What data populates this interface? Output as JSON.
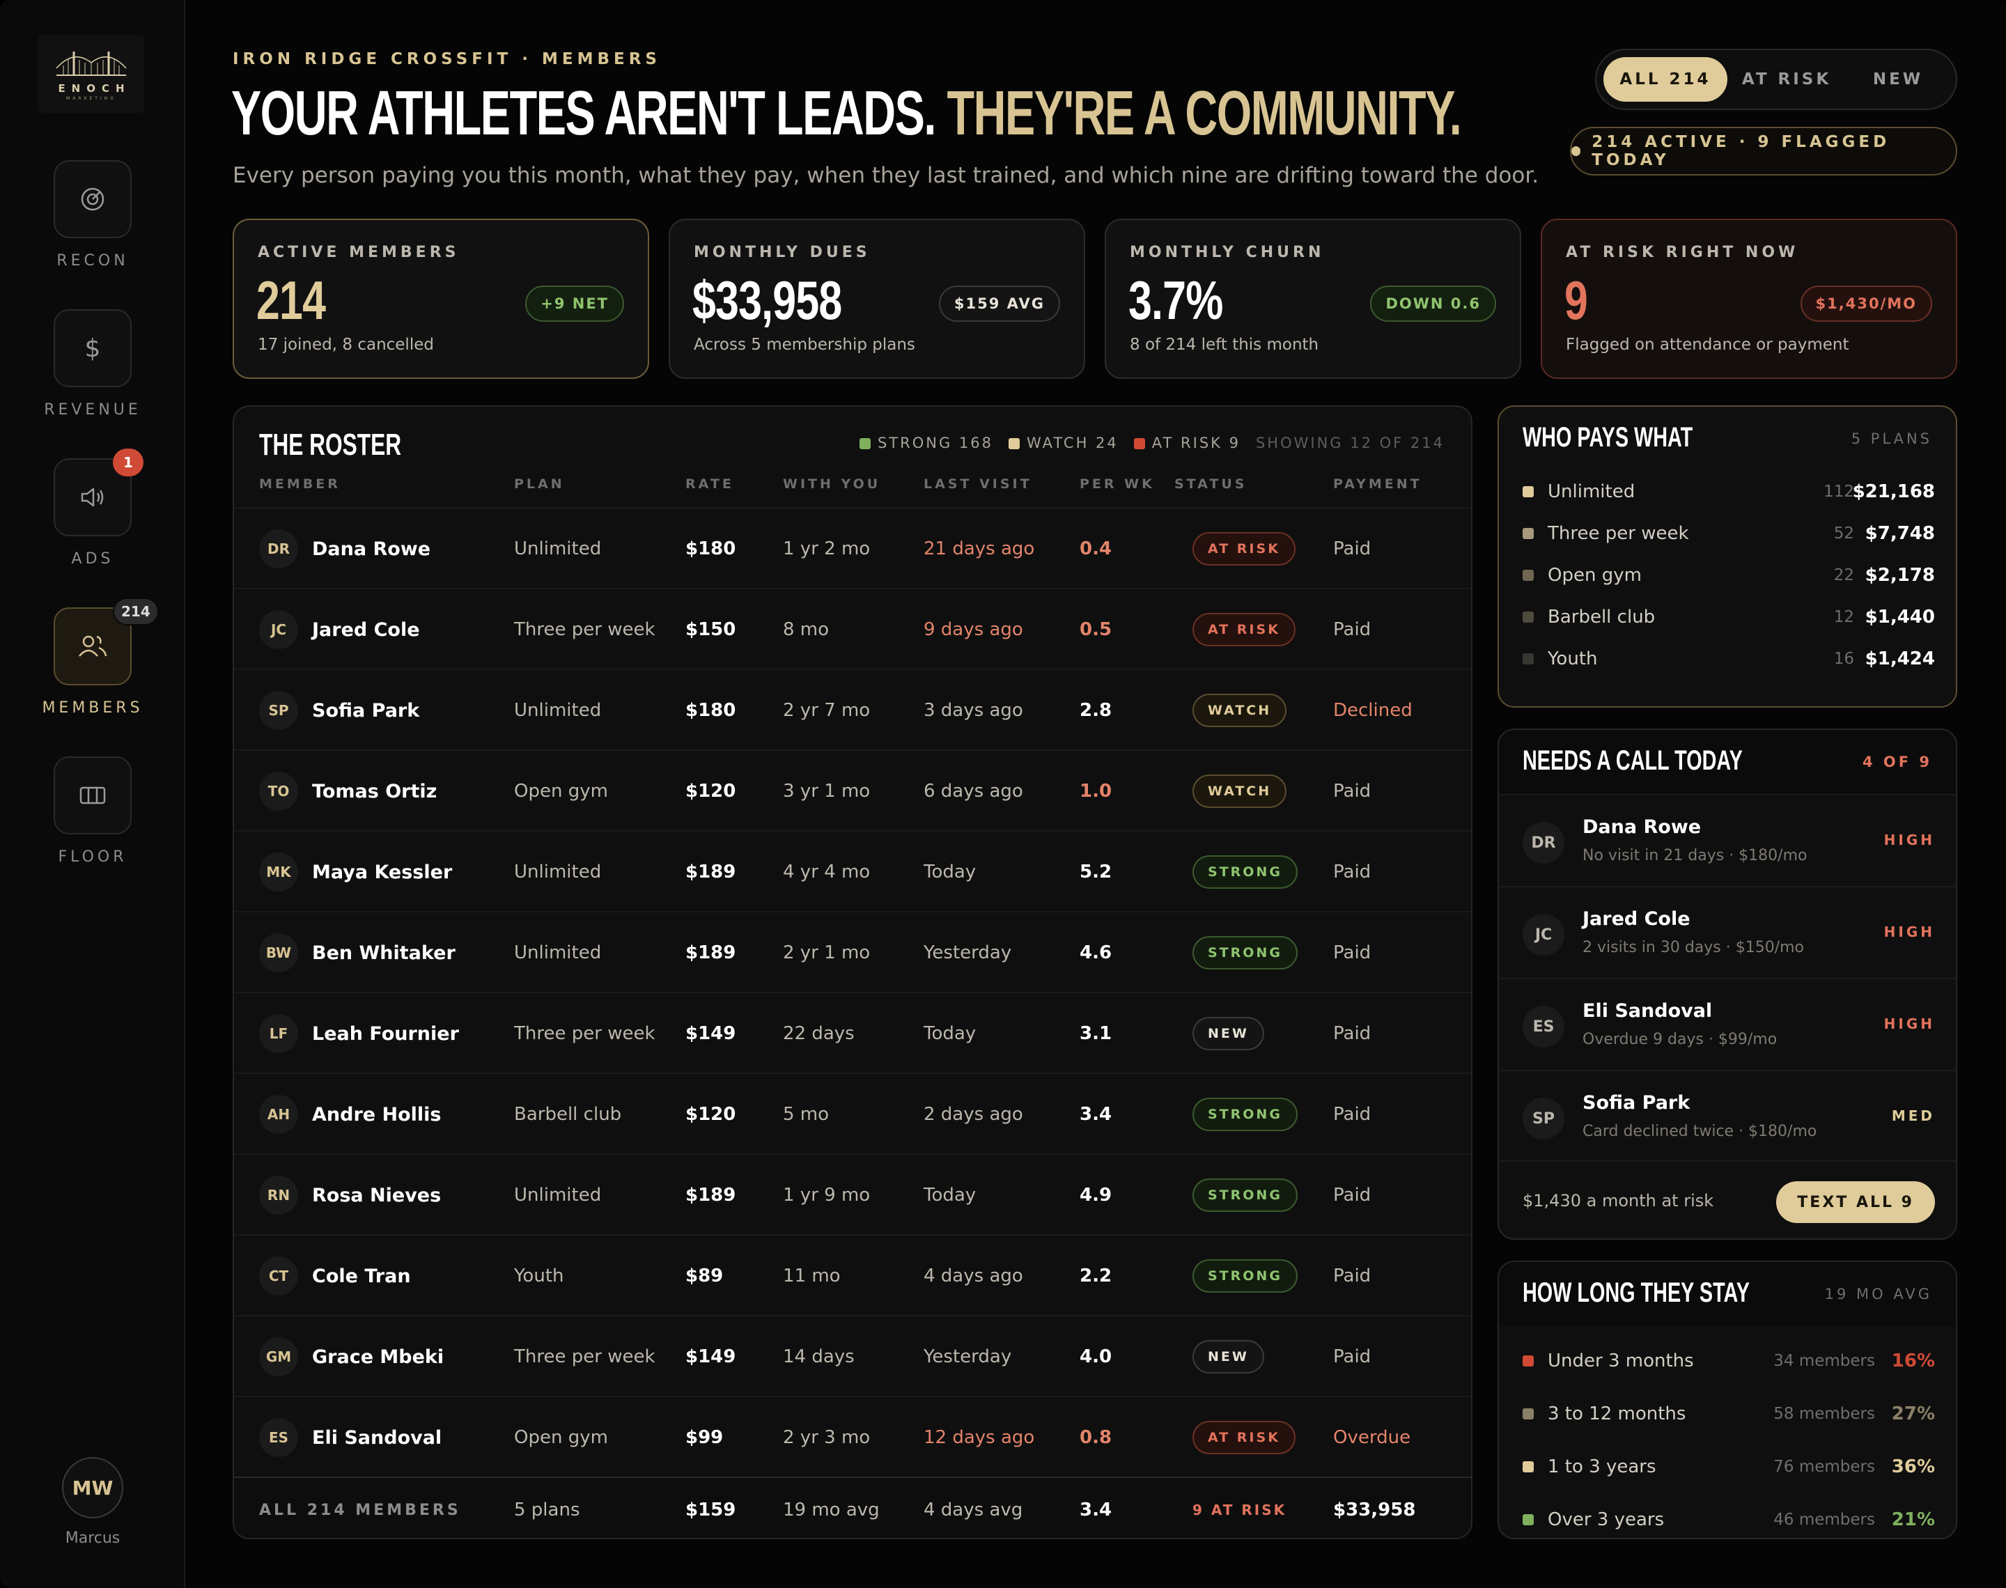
{
  "brand": {
    "name": "ENOCH",
    "sub": "MARKETING"
  },
  "nav": [
    {
      "id": "recon",
      "label": "RECON",
      "icon": "target-icon",
      "badge": ""
    },
    {
      "id": "revenue",
      "label": "REVENUE",
      "icon": "dollar-icon",
      "badge": ""
    },
    {
      "id": "ads",
      "label": "ADS",
      "icon": "speaker-icon",
      "badge": "1"
    },
    {
      "id": "members",
      "label": "MEMBERS",
      "icon": "users-icon",
      "badge": "214",
      "active": true
    },
    {
      "id": "floor",
      "label": "FLOOR",
      "icon": "floor-icon",
      "badge": ""
    }
  ],
  "user": {
    "initials": "MW",
    "name": "Marcus"
  },
  "header": {
    "eyebrow": "IRON RIDGE CROSSFIT · MEMBERS",
    "headline_a": "YOUR ATHLETES AREN'T LEADS.",
    "headline_b": "THEY'RE A COMMUNITY.",
    "subhead": "Every person paying you this month, what they pay, when they last trained, and which nine are drifting toward the door."
  },
  "filters": {
    "all": "ALL 214",
    "risk": "AT RISK",
    "new": "NEW"
  },
  "status_pill": "214 ACTIVE · 9 FLAGGED TODAY",
  "kpis": [
    {
      "label": "ACTIVE MEMBERS",
      "value": "214",
      "chip": "+9 NET",
      "sub": "17 joined, 8 cancelled"
    },
    {
      "label": "MONTHLY DUES",
      "value": "$33,958",
      "chip": "$159 AVG",
      "sub": "Across 5 membership plans"
    },
    {
      "label": "MONTHLY CHURN",
      "value": "3.7%",
      "chip": "DOWN 0.6",
      "sub": "8 of 214 left this month"
    },
    {
      "label": "AT RISK RIGHT NOW",
      "value": "9",
      "chip": "$1,430/MO",
      "sub": "Flagged on attendance or payment"
    }
  ],
  "roster": {
    "title": "THE ROSTER",
    "legend": {
      "strong": "STRONG 168",
      "watch": "WATCH 24",
      "risk": "AT RISK 9",
      "showing": "SHOWING 12 OF 214"
    },
    "columns": {
      "member": "MEMBER",
      "plan": "PLAN",
      "rate": "RATE",
      "with": "WITH YOU",
      "last": "LAST VISIT",
      "perwk": "PER WK",
      "status": "STATUS",
      "payment": "PAYMENT"
    },
    "rows": [
      {
        "initials": "DR",
        "name": "Dana Rowe",
        "plan": "Unlimited",
        "rate": "$180",
        "with": "1 yr 2 mo",
        "last": "21 days ago",
        "perwk": "0.4",
        "status": "AT RISK",
        "payment": "Paid"
      },
      {
        "initials": "JC",
        "name": "Jared Cole",
        "plan": "Three per week",
        "rate": "$150",
        "with": "8 mo",
        "last": "9 days ago",
        "perwk": "0.5",
        "status": "AT RISK",
        "payment": "Paid"
      },
      {
        "initials": "SP",
        "name": "Sofia Park",
        "plan": "Unlimited",
        "rate": "$180",
        "with": "2 yr 7 mo",
        "last": "3 days ago",
        "perwk": "2.8",
        "status": "WATCH",
        "payment": "Declined"
      },
      {
        "initials": "TO",
        "name": "Tomas Ortiz",
        "plan": "Open gym",
        "rate": "$120",
        "with": "3 yr 1 mo",
        "last": "6 days ago",
        "perwk": "1.0",
        "status": "WATCH",
        "payment": "Paid"
      },
      {
        "initials": "MK",
        "name": "Maya Kessler",
        "plan": "Unlimited",
        "rate": "$189",
        "with": "4 yr 4 mo",
        "last": "Today",
        "perwk": "5.2",
        "status": "STRONG",
        "payment": "Paid"
      },
      {
        "initials": "BW",
        "name": "Ben Whitaker",
        "plan": "Unlimited",
        "rate": "$189",
        "with": "2 yr 1 mo",
        "last": "Yesterday",
        "perwk": "4.6",
        "status": "STRONG",
        "payment": "Paid"
      },
      {
        "initials": "LF",
        "name": "Leah Fournier",
        "plan": "Three per week",
        "rate": "$149",
        "with": "22 days",
        "last": "Today",
        "perwk": "3.1",
        "status": "NEW",
        "payment": "Paid"
      },
      {
        "initials": "AH",
        "name": "Andre Hollis",
        "plan": "Barbell club",
        "rate": "$120",
        "with": "5 mo",
        "last": "2 days ago",
        "perwk": "3.4",
        "status": "STRONG",
        "payment": "Paid"
      },
      {
        "initials": "RN",
        "name": "Rosa Nieves",
        "plan": "Unlimited",
        "rate": "$189",
        "with": "1 yr 9 mo",
        "last": "Today",
        "perwk": "4.9",
        "status": "STRONG",
        "payment": "Paid"
      },
      {
        "initials": "CT",
        "name": "Cole Tran",
        "plan": "Youth",
        "rate": "$89",
        "with": "11 mo",
        "last": "4 days ago",
        "perwk": "2.2",
        "status": "STRONG",
        "payment": "Paid"
      },
      {
        "initials": "GM",
        "name": "Grace Mbeki",
        "plan": "Three per week",
        "rate": "$149",
        "with": "14 days",
        "last": "Yesterday",
        "perwk": "4.0",
        "status": "NEW",
        "payment": "Paid"
      },
      {
        "initials": "ES",
        "name": "Eli Sandoval",
        "plan": "Open gym",
        "rate": "$99",
        "with": "2 yr 3 mo",
        "last": "12 days ago",
        "perwk": "0.8",
        "status": "AT RISK",
        "payment": "Overdue"
      }
    ],
    "footer": {
      "member": "ALL 214 MEMBERS",
      "plan": "5 plans",
      "rate": "$159",
      "with": "19 mo avg",
      "last": "4 days avg",
      "perwk": "3.4",
      "status": "9 AT RISK",
      "payment": "$33,958"
    }
  },
  "plans": {
    "title": "WHO PAYS WHAT",
    "meta": "5 PLANS",
    "items": [
      {
        "name": "Unlimited",
        "count": "112",
        "amount": "$21,168",
        "color": "#e0cc9a"
      },
      {
        "name": "Three per week",
        "count": "52",
        "amount": "$7,748",
        "color": "#a8997a"
      },
      {
        "name": "Open gym",
        "count": "22",
        "amount": "$2,178",
        "color": "#6e6650"
      },
      {
        "name": "Barbell club",
        "count": "12",
        "amount": "$1,440",
        "color": "#4e4a3c"
      },
      {
        "name": "Youth",
        "count": "16",
        "amount": "$1,424",
        "color": "#383630"
      }
    ]
  },
  "calls": {
    "title": "NEEDS A CALL TODAY",
    "meta": "4 OF 9",
    "items": [
      {
        "initials": "DR",
        "name": "Dana Rowe",
        "sub": "No visit in 21 days · $180/mo",
        "priority": "HIGH"
      },
      {
        "initials": "JC",
        "name": "Jared Cole",
        "sub": "2 visits in 30 days · $150/mo",
        "priority": "HIGH"
      },
      {
        "initials": "ES",
        "name": "Eli Sandoval",
        "sub": "Overdue 9 days · $99/mo",
        "priority": "HIGH"
      },
      {
        "initials": "SP",
        "name": "Sofia Park",
        "sub": "Card declined twice · $180/mo",
        "priority": "MED"
      }
    ],
    "footer": "$1,430 a month at risk",
    "button": "TEXT ALL 9"
  },
  "stay": {
    "title": "HOW LONG THEY STAY",
    "meta": "19 MO AVG",
    "items": [
      {
        "name": "Under 3 months",
        "count": "34 members",
        "pct": "16%",
        "color": "#d04a36"
      },
      {
        "name": "3 to 12 months",
        "count": "58 members",
        "pct": "27%",
        "color": "#8a8068"
      },
      {
        "name": "1 to 3 years",
        "count": "76 members",
        "pct": "36%",
        "color": "#e0cc9a"
      },
      {
        "name": "Over 3 years",
        "count": "46 members",
        "pct": "21%",
        "color": "#7fb05e"
      }
    ]
  }
}
